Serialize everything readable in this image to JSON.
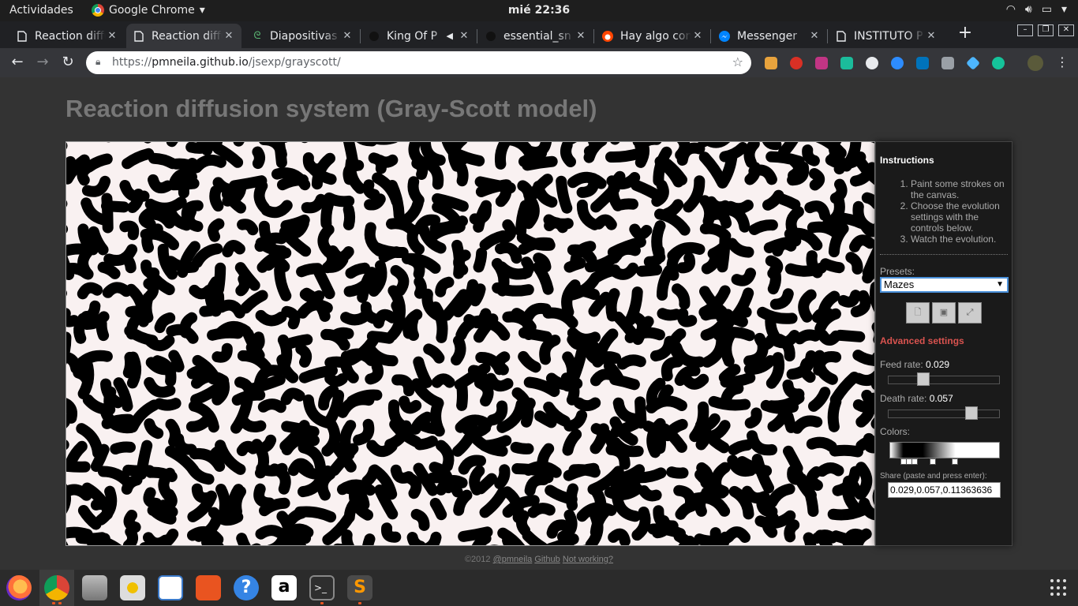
{
  "topbar": {
    "activities": "Actividades",
    "app_name": "Google Chrome",
    "clock": "mié 22:36"
  },
  "tabs": [
    {
      "title": "Reaction diffusion",
      "icon": "page-icon",
      "active": false
    },
    {
      "title": "Reaction diffusion",
      "icon": "page-icon",
      "active": true
    },
    {
      "title": "Diapositivas",
      "icon": "leaf-icon",
      "active": false
    },
    {
      "title": "King Of P",
      "icon": "circle-icon",
      "active": false
    },
    {
      "title": "essential_sn",
      "icon": "circle-icon",
      "active": false
    },
    {
      "title": "Hay algo con",
      "icon": "reddit-icon",
      "active": false
    },
    {
      "title": "Messenger",
      "icon": "messenger-icon",
      "active": false
    },
    {
      "title": "INSTITUTO P",
      "icon": "page-icon",
      "active": false
    }
  ],
  "omnibox": {
    "url_prefix": "https://",
    "url_host": "pmneila.github.io",
    "url_path": "/jsexp/grayscott/"
  },
  "page": {
    "title": "Reaction diffusion system (Gray-Scott model)"
  },
  "panel": {
    "instructions_title": "Instructions",
    "steps": [
      "Paint some strokes on the canvas.",
      "Choose the evolution settings with the controls below.",
      "Watch the evolution."
    ],
    "presets_label": "Presets:",
    "preset_value": "Mazes",
    "advanced_title": "Advanced settings",
    "feed_label": "Feed rate:",
    "feed_value": "0.029",
    "feed_level": 0.29,
    "death_label": "Death rate:",
    "death_value": "0.057",
    "death_level": 0.78,
    "colors_label": "Colors:",
    "share_label": "Share (paste and press enter):",
    "share_value": "0.029,0.057,0.11363636"
  },
  "footer": {
    "copyright": "©2012",
    "author_link": "@pmneila",
    "github_link": "Github",
    "notworking_link": "Not working?"
  },
  "colors": {
    "page_bg": "#333333",
    "title": "#777777",
    "advanced": "#d9534f",
    "select_border": "#4a90d9"
  }
}
